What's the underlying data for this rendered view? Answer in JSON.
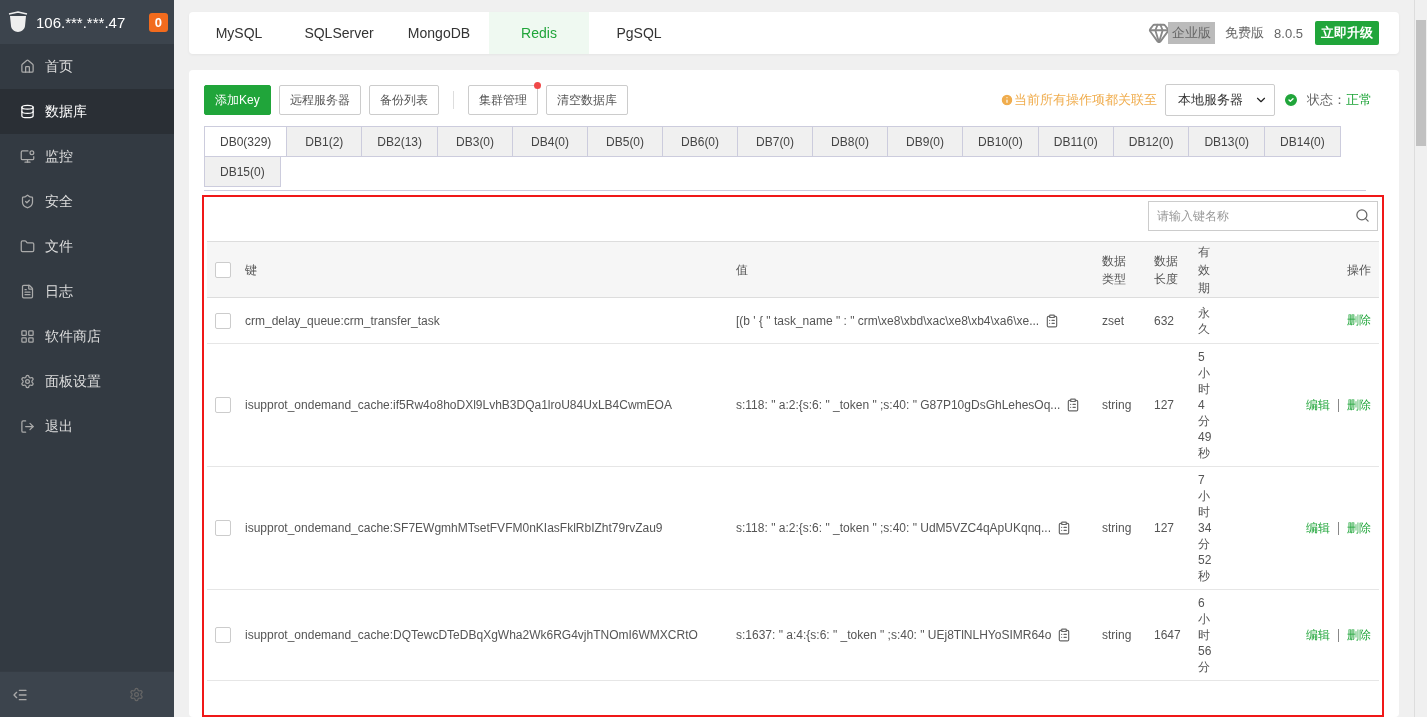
{
  "sidebar": {
    "host": "106.***.***.47",
    "badge": "0",
    "items": [
      {
        "label": "首页",
        "kind": "home",
        "selected": false
      },
      {
        "label": "数据库",
        "kind": "database",
        "selected": true
      },
      {
        "label": "监控",
        "kind": "monitor",
        "selected": false
      },
      {
        "label": "安全",
        "kind": "shield",
        "selected": false
      },
      {
        "label": "文件",
        "kind": "folder",
        "selected": false
      },
      {
        "label": "日志",
        "kind": "log",
        "selected": false
      },
      {
        "label": "软件商店",
        "kind": "store",
        "selected": false
      },
      {
        "label": "面板设置",
        "kind": "settings",
        "selected": false
      },
      {
        "label": "退出",
        "kind": "logout",
        "selected": false
      }
    ]
  },
  "db_types": [
    {
      "label": "MySQL",
      "selected": false
    },
    {
      "label": "SQLServer",
      "selected": false
    },
    {
      "label": "MongoDB",
      "selected": false
    },
    {
      "label": "Redis",
      "selected": true
    },
    {
      "label": "PgSQL",
      "selected": false
    }
  ],
  "edition": {
    "enterprise": "企业版",
    "free": "免费版",
    "version": "8.0.5",
    "upgrade": "立即升级"
  },
  "toolbar": {
    "buttons": [
      {
        "label": "添加Key",
        "kind": "primary",
        "dot": false
      },
      {
        "label": "远程服务器",
        "kind": "default",
        "dot": false
      },
      {
        "label": "备份列表",
        "kind": "default",
        "dot": false
      },
      {
        "label": "集群管理",
        "kind": "default",
        "dot": true
      },
      {
        "label": "清空数据库",
        "kind": "default",
        "dot": false
      }
    ],
    "notice": "当前所有操作项都关联至",
    "server": "本地服务器",
    "status_label": "状态：",
    "status_value": "正常"
  },
  "db_tabs": [
    {
      "label": "DB0(329)",
      "selected": true
    },
    {
      "label": "DB1(2)",
      "selected": false
    },
    {
      "label": "DB2(13)",
      "selected": false
    },
    {
      "label": "DB3(0)",
      "selected": false
    },
    {
      "label": "DB4(0)",
      "selected": false
    },
    {
      "label": "DB5(0)",
      "selected": false
    },
    {
      "label": "DB6(0)",
      "selected": false
    },
    {
      "label": "DB7(0)",
      "selected": false
    },
    {
      "label": "DB8(0)",
      "selected": false
    },
    {
      "label": "DB9(0)",
      "selected": false
    },
    {
      "label": "DB10(0)",
      "selected": false
    },
    {
      "label": "DB11(0)",
      "selected": false
    },
    {
      "label": "DB12(0)",
      "selected": false
    },
    {
      "label": "DB13(0)",
      "selected": false
    },
    {
      "label": "DB14(0)",
      "selected": false
    },
    {
      "label": "DB15(0)",
      "selected": false
    }
  ],
  "search": {
    "placeholder": "请输入键名称"
  },
  "table": {
    "columns": [
      "键",
      "值",
      "数据类型",
      "数据长度",
      "有效期",
      "操作"
    ],
    "all_checked": false,
    "rows": [
      {
        "checked": false,
        "key": "crm_delay_queue:crm_transfer_task",
        "value": "[(b ' { \" task_name \" : \" crm\\xe8\\xbd\\xac\\xe8\\xb4\\xa6\\xe...",
        "type": "zset",
        "length": "632",
        "expiry": "永久",
        "actions": [
          "删除"
        ]
      },
      {
        "checked": false,
        "key": "isupprot_ondemand_cache:if5Rw4o8hoDXl9LvhB3DQa1lroU84UxLB4CwmEOA",
        "value": "s:118: \" a:2:{s:6: \" _token \" ;s:40: \" G87P10gDsGhLehesOq...",
        "type": "string",
        "length": "127",
        "expiry": "5小时4分49秒",
        "actions": [
          "编辑",
          "删除"
        ]
      },
      {
        "checked": false,
        "key": "isupprot_ondemand_cache:SF7EWgmhMTsetFVFM0nKIasFklRbIZht79rvZau9",
        "value": "s:118: \" a:2:{s:6: \" _token \" ;s:40: \" UdM5VZC4qApUKqnq...",
        "type": "string",
        "length": "127",
        "expiry": "7小时34分52秒",
        "actions": [
          "编辑",
          "删除"
        ]
      },
      {
        "checked": false,
        "key": "isupprot_ondemand_cache:DQTewcDTeDBqXgWha2Wk6RG4vjhTNOmI6WMXCRtO",
        "value": "s:1637: \" a:4:{s:6: \" _token \" ;s:40: \" UEj8TlNLHYoSIMR64o",
        "type": "string",
        "length": "1647",
        "expiry": "6小时56分",
        "actions": [
          "编辑",
          "删除"
        ]
      }
    ]
  }
}
